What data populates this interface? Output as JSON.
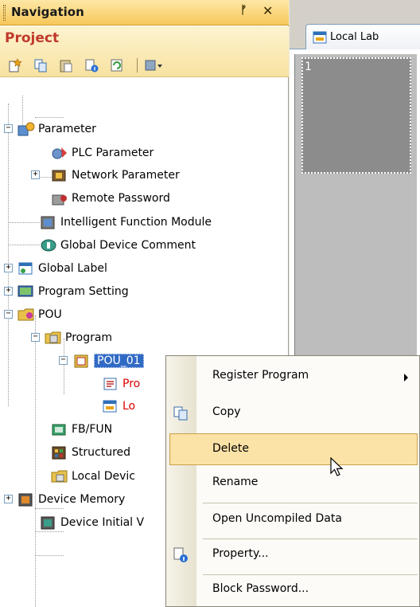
{
  "navigation": {
    "title": "Navigation",
    "pin_icon": "pin-icon",
    "close_icon": "close-icon",
    "project_label": "Project",
    "toolbar": [
      "new-data-icon",
      "copy-icon",
      "paste-icon",
      "property-icon",
      "refresh-icon",
      "filter-icon"
    ]
  },
  "tree": [
    {
      "label": "Parameter",
      "expander": "−"
    },
    {
      "label": "PLC Parameter"
    },
    {
      "label": "Network Parameter",
      "expander": "+"
    },
    {
      "label": "Remote Password"
    },
    {
      "label": "Intelligent Function Module"
    },
    {
      "label": "Global Device Comment"
    },
    {
      "label": "Global Label",
      "expander": "+"
    },
    {
      "label": "Program Setting",
      "expander": "+"
    },
    {
      "label": "POU",
      "expander": "−"
    },
    {
      "label": "Program",
      "expander": "−"
    },
    {
      "label": "POU_01",
      "expander": "−",
      "selected": true
    },
    {
      "label": "Pro"
    },
    {
      "label": "Lo"
    },
    {
      "label": "FB/FUN"
    },
    {
      "label": "Structured"
    },
    {
      "label": "Local Devic"
    },
    {
      "label": "Device Memory",
      "expander": "+"
    },
    {
      "label": "Device Initial V"
    }
  ],
  "editor": {
    "tab_label": "Local Lab",
    "cell_number": "1"
  },
  "context_menu": {
    "items": [
      {
        "label": "Register Program",
        "has_submenu": true
      },
      {
        "label": "Copy",
        "icon": "copy-icon"
      },
      {
        "label": "Delete",
        "highlighted": true
      },
      {
        "label": "Rename"
      },
      {
        "label": "Open Uncompiled Data"
      },
      {
        "label": "Property...",
        "icon": "property-icon"
      },
      {
        "label": "Block Password..."
      }
    ]
  },
  "colors": {
    "accent_header": "#f7c75a",
    "project_title": "#c0392b",
    "selection": "#316ac5",
    "menu_highlight": "#fbe2a6"
  }
}
